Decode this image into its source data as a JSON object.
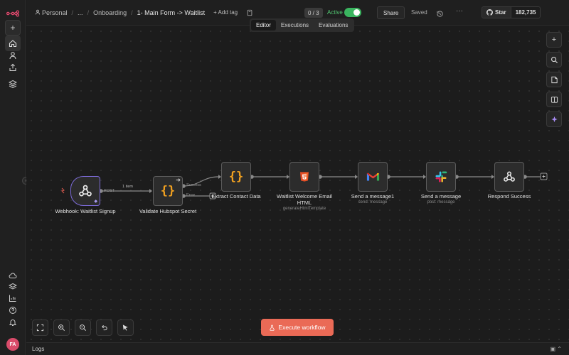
{
  "header": {
    "crumb_personal": "Personal",
    "crumb_ellipsis": "...",
    "crumb_folder": "Onboarding",
    "workflow_title": "1- Main Form -> Waitlist",
    "add_tag": "+ Add tag",
    "counter": "0 / 3",
    "active_label": "Active",
    "active": true,
    "share": "Share",
    "saved": "Saved",
    "github_star": "Star",
    "github_count": "182,735"
  },
  "tabs": [
    {
      "label": "Editor",
      "selected": true
    },
    {
      "label": "Executions",
      "selected": false
    },
    {
      "label": "Evaluations",
      "selected": false
    }
  ],
  "nodes": [
    {
      "label": "Webhook: Waitlist Signup",
      "sub": "",
      "icon": "webhook-icon"
    },
    {
      "label": "Validate Hubspot Secret",
      "sub": "",
      "icon": "code-braces-icon"
    },
    {
      "label": "Extract Contact Data",
      "sub": "",
      "icon": "code-braces-icon"
    },
    {
      "label": "Waitlist Welcome Email HTML",
      "sub": "generateHtmlTemplate",
      "icon": "html5-icon"
    },
    {
      "label": "Send a message1",
      "sub": "send: message",
      "icon": "gmail-icon"
    },
    {
      "label": "Send a message",
      "sub": "post: message",
      "icon": "slack-icon"
    },
    {
      "label": "Respond Success",
      "sub": "",
      "icon": "webhook-icon"
    }
  ],
  "edge_labels": {
    "post": "POST",
    "items": "1 item",
    "success": "Success",
    "error": "Error"
  },
  "execute_button": "Execute workflow",
  "logs_label": "Logs",
  "user_initials": "FA",
  "colors": {
    "accent": "#ea6a56",
    "active_green": "#3ab55f",
    "trigger_border": "#7c6bd8",
    "code_orange": "#f0a020"
  }
}
